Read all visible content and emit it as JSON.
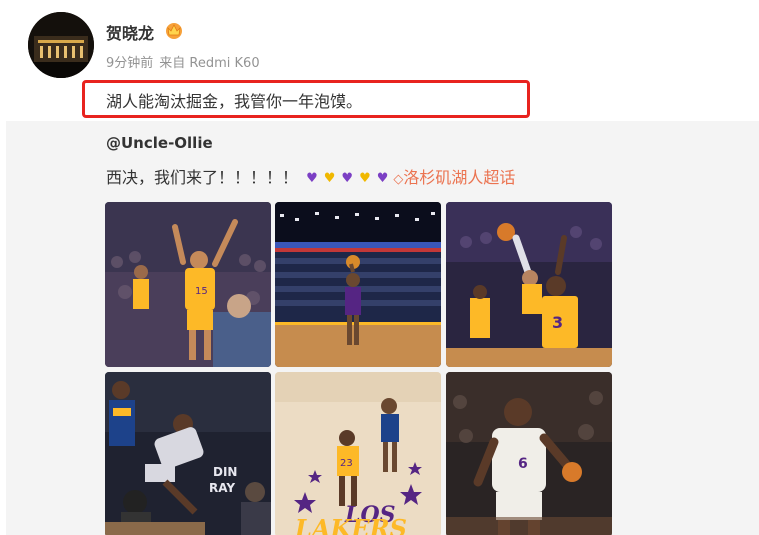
{
  "user": {
    "name": "贺晓龙",
    "time": "9分钟前",
    "source": "来自 Redmi K60"
  },
  "post": {
    "text": "湖人能淘汰掘金，我管你一年泡馍。"
  },
  "repost": {
    "author": "@Uncle-Ollie",
    "text": "西决，我们来了！！！！！",
    "hearts": [
      "purple",
      "gold",
      "purple",
      "gold",
      "purple"
    ],
    "topic": "洛杉矶湖人超话"
  },
  "images": [
    {
      "icon": "lakers-player-celebrating-image"
    },
    {
      "icon": "arena-free-throw-image"
    },
    {
      "icon": "lakers-block-shot-image"
    },
    {
      "icon": "lebron-warriors-scramble-image"
    },
    {
      "icon": "court-logo-players-image"
    },
    {
      "icon": "lebron-dribbling-image"
    }
  ],
  "colors": {
    "accent": "#eb7350",
    "highlight_box": "#e8231f",
    "lakers_gold": "#fdb927",
    "lakers_purple": "#552583",
    "warriors_blue": "#1d428a"
  }
}
